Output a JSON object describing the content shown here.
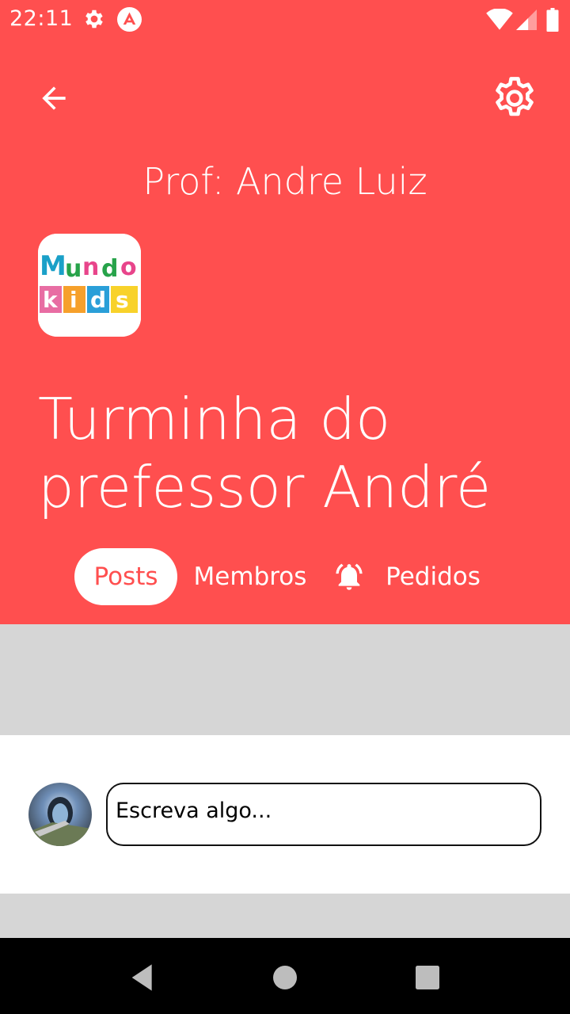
{
  "status_bar": {
    "time": "22:11",
    "icons": [
      "gear-icon",
      "app-notification-icon",
      "wifi-icon",
      "signal-icon",
      "battery-icon"
    ]
  },
  "header": {
    "background": "#ff4f4f",
    "back_icon": "arrow-left-icon",
    "settings_icon": "gear-icon",
    "professor": "Prof: Andre Luiz",
    "logo_text": [
      "Mundo",
      "kids"
    ],
    "group_title_line1": "Turminha do",
    "group_title_line2": "prefessor André"
  },
  "tabs": [
    {
      "label": "Posts",
      "active": true
    },
    {
      "label": "Membros",
      "active": false
    },
    {
      "label": "Pedidos",
      "active": false,
      "icon": "bell-ringing-icon"
    }
  ],
  "composer": {
    "avatar_icon": "user-avatar",
    "input_placeholder": "Escreva algo..."
  },
  "nav_bar": {
    "icons": [
      "back-triangle-icon",
      "home-circle-icon",
      "recents-square-icon"
    ]
  }
}
